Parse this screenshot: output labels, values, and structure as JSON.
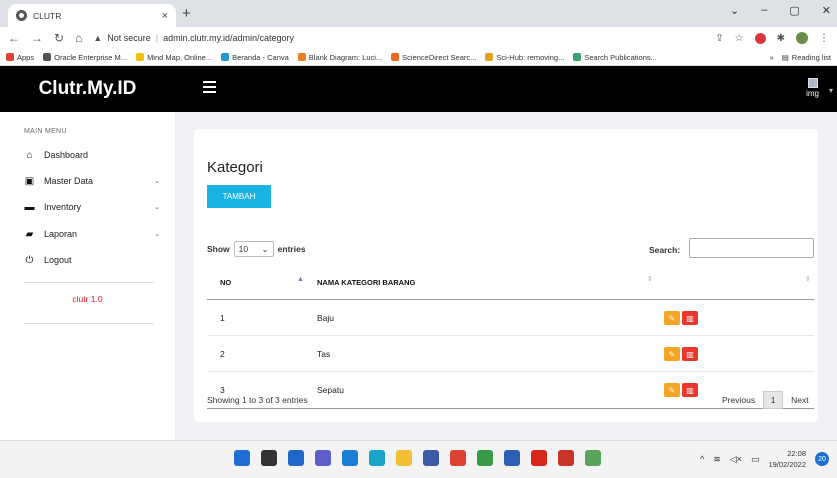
{
  "browser": {
    "tab_title": "CLUTR",
    "tab_close": "×",
    "new_tab": "+",
    "url_warning": "Not secure",
    "url": "admin.clutr.my.id/admin/category",
    "bookmarks": [
      {
        "label": "Apps",
        "color": "#e34133"
      },
      {
        "label": "Oracle Enterprise M...",
        "color": "#555555"
      },
      {
        "label": "Mind Map, Online...",
        "color": "#f2c200"
      },
      {
        "label": "Beranda - Canva",
        "color": "#1d9ad6"
      },
      {
        "label": "Blank Diagram: Luci...",
        "color": "#f47d20"
      },
      {
        "label": "ScienceDirect Searc...",
        "color": "#f16a21"
      },
      {
        "label": "Sci-Hub: removing...",
        "color": "#e1a11c"
      },
      {
        "label": "Search Publications...",
        "color": "#3aa070"
      }
    ],
    "reading_list": "Reading list",
    "more_bookmarks": "»"
  },
  "app": {
    "brand": "Clutr.My.ID",
    "user_img_alt": "img",
    "menu_heading": "MAIN MENU",
    "menu": [
      {
        "label": "Dashboard",
        "icon": "home-icon",
        "glyph": "⌂",
        "has_sub": false
      },
      {
        "label": "Master Data",
        "icon": "database-icon",
        "glyph": "▣",
        "has_sub": true
      },
      {
        "label": "Inventory",
        "icon": "inventory-icon",
        "glyph": "▬",
        "has_sub": true
      },
      {
        "label": "Laporan",
        "icon": "book-icon",
        "glyph": "▰",
        "has_sub": true
      },
      {
        "label": "Logout",
        "icon": "power-icon",
        "glyph": "⏻",
        "has_sub": false
      }
    ],
    "version": "clutr 1.0"
  },
  "page": {
    "title": "Kategori",
    "add_button": "TAMBAH",
    "length_prefix": "Show",
    "length_value": "10",
    "length_suffix": "entries",
    "search_label": "Search:",
    "search_value": "",
    "columns": [
      "NO",
      "NAMA KATEGORI BARANG",
      ""
    ],
    "rows": [
      {
        "no": "1",
        "name": "Baju"
      },
      {
        "no": "2",
        "name": "Tas"
      },
      {
        "no": "3",
        "name": "Sepatu"
      }
    ],
    "info": "Showing 1 to 3 of 3 entries",
    "pager": {
      "previous": "Previous",
      "current": "1",
      "next": "Next"
    }
  },
  "taskbar": {
    "time": "22:08",
    "date": "19/02/2022",
    "notifications": "20",
    "apps": [
      {
        "name": "windows-start-icon",
        "color": "#1f6fd6"
      },
      {
        "name": "search-icon",
        "color": "#333333"
      },
      {
        "name": "task-view-icon",
        "color": "#2166c9"
      },
      {
        "name": "chat-icon",
        "color": "#5b5fc7"
      },
      {
        "name": "mail-icon",
        "color": "#1b7ed4"
      },
      {
        "name": "edge-icon",
        "color": "#18a5c9"
      },
      {
        "name": "file-explorer-icon",
        "color": "#f0c034"
      },
      {
        "name": "store-icon",
        "color": "#3b5ba8"
      },
      {
        "name": "chrome-icon",
        "color": "#de4032"
      },
      {
        "name": "chrome-profile-icon",
        "color": "#3a9a48"
      },
      {
        "name": "word-icon",
        "color": "#2b5fb4"
      },
      {
        "name": "acrobat-icon",
        "color": "#d9261c"
      },
      {
        "name": "powerpoint-icon",
        "color": "#c9352b"
      },
      {
        "name": "chrome-alt-icon",
        "color": "#5aa45a"
      }
    ]
  }
}
